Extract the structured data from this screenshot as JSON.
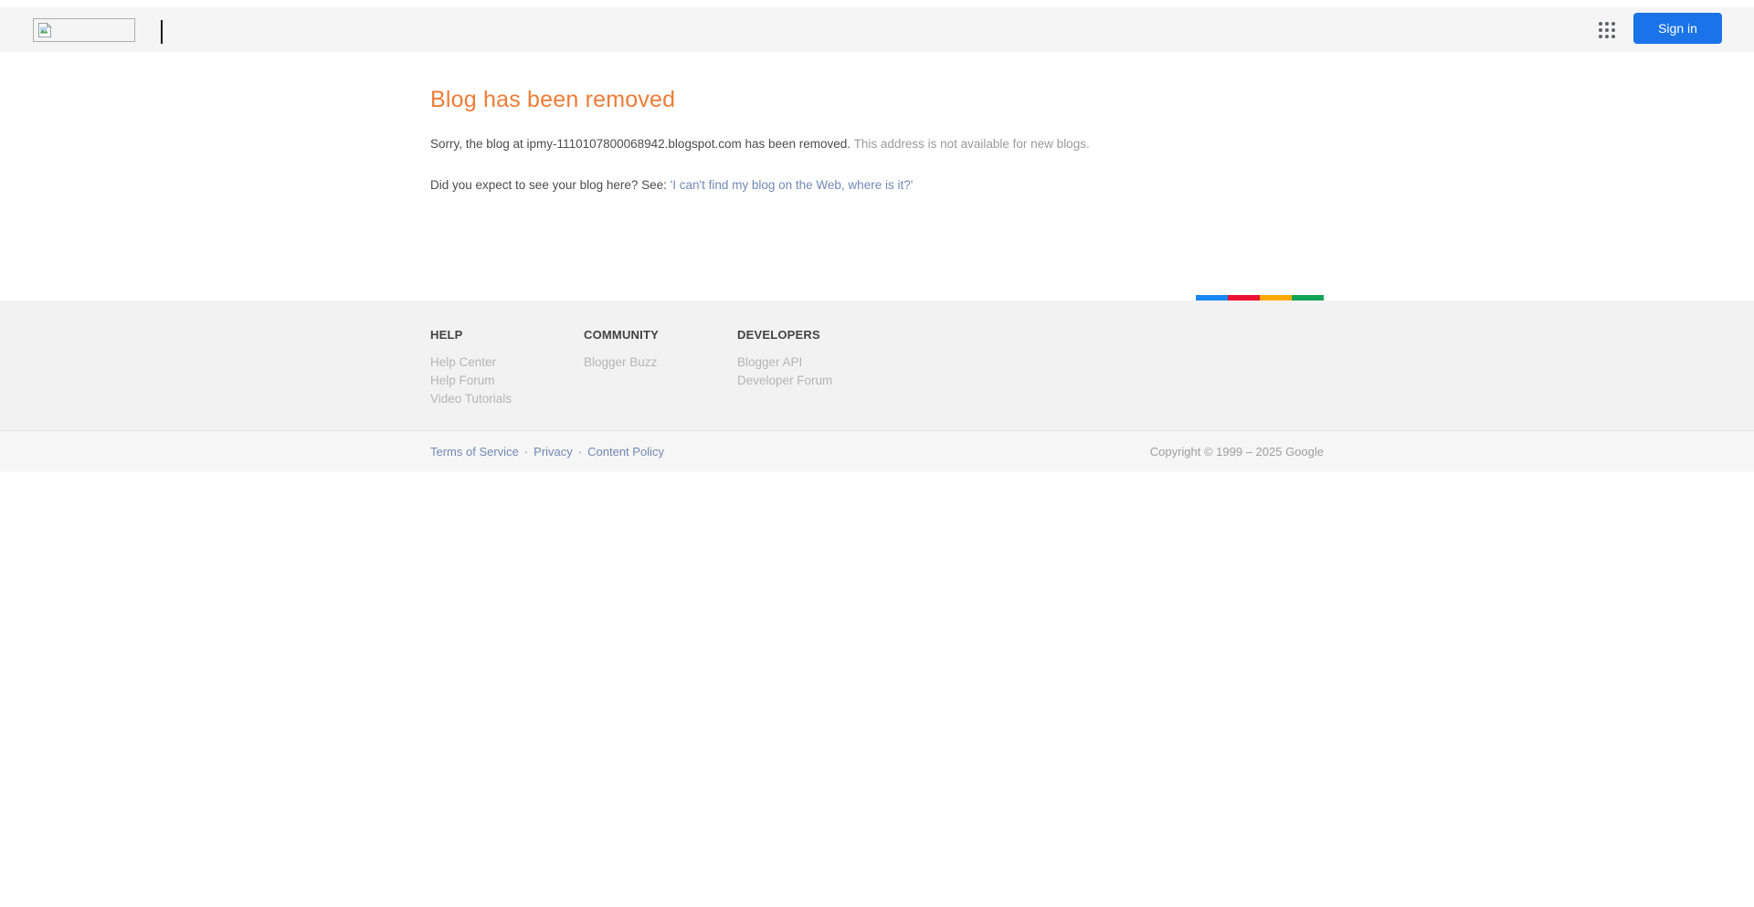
{
  "header": {
    "sign_in_label": "Sign in"
  },
  "main": {
    "title": "Blog has been removed",
    "message_primary": "Sorry, the blog at ipmy-1110107800068942.blogspot.com has been removed.",
    "message_secondary": " This address is not available for new blogs.",
    "prompt_text": "Did you expect to see your blog here? See: ",
    "prompt_link": "'I can't find my blog on the Web, where is it?'"
  },
  "footer": {
    "columns": [
      {
        "heading": "HELP",
        "links": [
          "Help Center",
          "Help Forum",
          "Video Tutorials"
        ]
      },
      {
        "heading": "COMMUNITY",
        "links": [
          "Blogger Buzz"
        ]
      },
      {
        "heading": "DEVELOPERS",
        "links": [
          "Blogger API",
          "Developer Forum"
        ]
      }
    ],
    "legal_links": [
      "Terms of Service",
      "Privacy",
      "Content Policy"
    ],
    "separator": "·",
    "copyright": "Copyright © 1999 – 2025 Google",
    "brand_bar_colors": [
      "#1a87f8",
      "#ed1134",
      "#fbaa00",
      "#12a454"
    ]
  },
  "colors": {
    "accent_orange": "#ee7c35",
    "link_blue": "#7289b5",
    "button_blue": "#1a73e8"
  }
}
